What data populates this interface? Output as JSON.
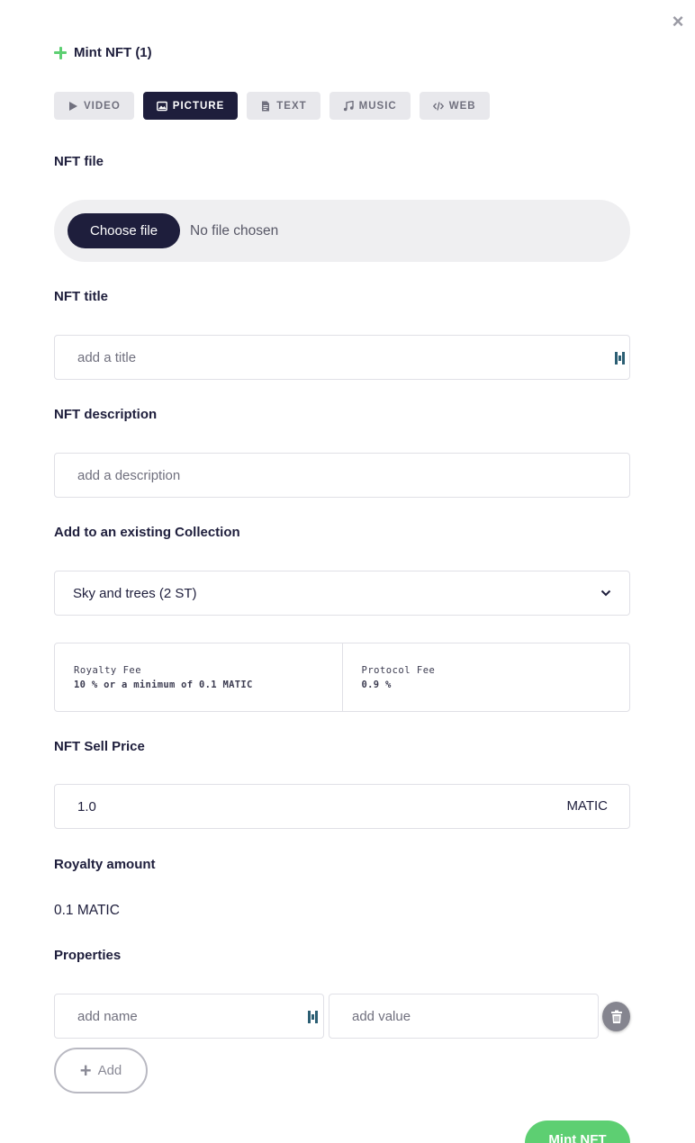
{
  "close_label": "×",
  "header": {
    "title": "Mint NFT (1)"
  },
  "tabs": [
    {
      "label": "VIDEO",
      "icon": "play-icon"
    },
    {
      "label": "PICTURE",
      "icon": "image-icon",
      "active": true
    },
    {
      "label": "TEXT",
      "icon": "document-icon"
    },
    {
      "label": "MUSIC",
      "icon": "music-note-icon"
    },
    {
      "label": "WEB",
      "icon": "code-icon"
    }
  ],
  "file": {
    "label": "NFT file",
    "button": "Choose file",
    "status": "No file chosen"
  },
  "title": {
    "label": "NFT title",
    "placeholder": "add a title"
  },
  "description": {
    "label": "NFT description",
    "placeholder": "add a description"
  },
  "collection": {
    "label": "Add to an existing Collection",
    "selected": "Sky and trees (2 ST)"
  },
  "fees": {
    "royalty_label": "Royalty Fee",
    "royalty_value": "10 % or a minimum of 0.1 MATIC",
    "protocol_label": "Protocol Fee",
    "protocol_value": "0.9 %"
  },
  "price": {
    "label": "NFT Sell Price",
    "value": "1.0",
    "unit": "MATIC"
  },
  "royalty": {
    "label": "Royalty amount",
    "value": "0.1 MATIC"
  },
  "properties": {
    "label": "Properties",
    "name_placeholder": "add name",
    "value_placeholder": "add value",
    "add_label": "Add"
  },
  "submit": {
    "label": "Mint NFT"
  },
  "colors": {
    "primary": "#1e1e3c",
    "accent": "#5dcf72",
    "muted": "#efeff1"
  }
}
